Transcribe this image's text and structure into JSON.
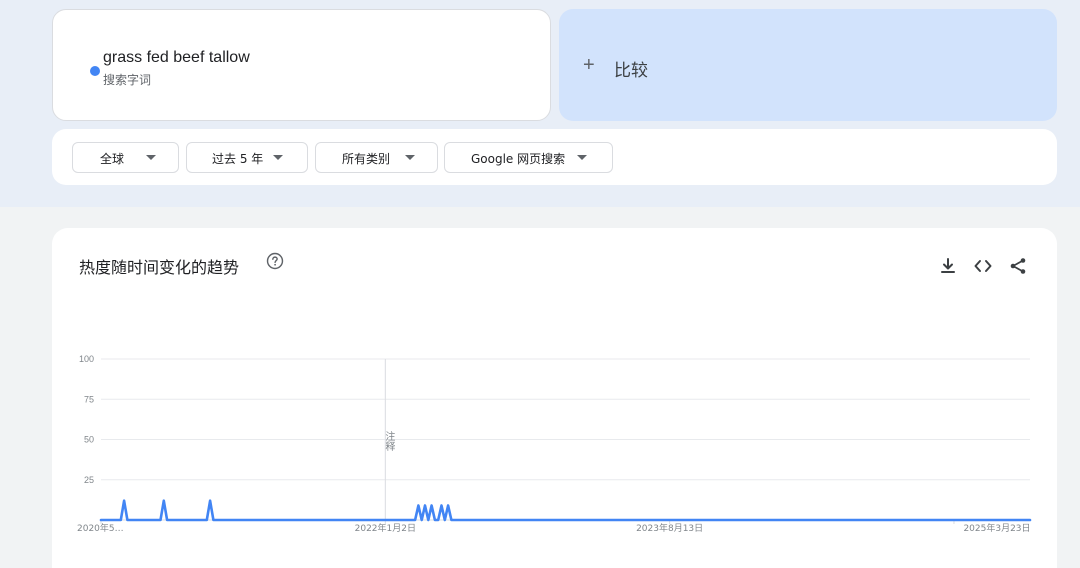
{
  "search_term": {
    "name": "grass fed beef tallow",
    "subtitle": "搜索字词",
    "color": "#4285f4"
  },
  "compare": {
    "plus": "+",
    "label": "比较"
  },
  "filters": [
    {
      "label": "全球"
    },
    {
      "label": "过去 5 年"
    },
    {
      "label": "所有类别"
    },
    {
      "label": "Google 网页搜索"
    }
  ],
  "chart_section": {
    "title": "热度随时间变化的趋势",
    "note_label": "注释"
  },
  "chart_data": {
    "type": "line",
    "xlabel": "",
    "ylabel": "",
    "ylim": [
      0,
      100
    ],
    "y_ticks": [
      25,
      50,
      75,
      100
    ],
    "x_tick_labels": [
      "2020年5…",
      "2022年1月2日",
      "2023年8月13日",
      "2025年3月23日"
    ],
    "x_tick_index": [
      0,
      86,
      172,
      258
    ],
    "note_index": 86,
    "grid": true,
    "series": [
      {
        "color": "#4285f4",
        "values": [
          0,
          0,
          0,
          0,
          0,
          0,
          0,
          12,
          0,
          0,
          0,
          0,
          0,
          0,
          0,
          0,
          0,
          0,
          0,
          12,
          0,
          0,
          0,
          0,
          0,
          0,
          0,
          0,
          0,
          0,
          0,
          0,
          0,
          12,
          0,
          0,
          0,
          0,
          0,
          0,
          0,
          0,
          0,
          0,
          0,
          0,
          0,
          0,
          0,
          0,
          0,
          0,
          0,
          0,
          0,
          0,
          0,
          0,
          0,
          0,
          0,
          0,
          0,
          0,
          0,
          0,
          0,
          0,
          0,
          0,
          0,
          0,
          0,
          0,
          0,
          0,
          0,
          0,
          0,
          0,
          0,
          0,
          0,
          0,
          0,
          0,
          0,
          0,
          0,
          0,
          0,
          0,
          0,
          0,
          0,
          0,
          9,
          0,
          9,
          0,
          9,
          0,
          0,
          9,
          0,
          9,
          0,
          0,
          0,
          0,
          0,
          0,
          0,
          0,
          0,
          0,
          0,
          0,
          0,
          0,
          0,
          0,
          0,
          0,
          0,
          0,
          0,
          0,
          0,
          0,
          0,
          0,
          0,
          0,
          0,
          0,
          0,
          0,
          0,
          0,
          0,
          0,
          0,
          0,
          0,
          0,
          0,
          0,
          0,
          0,
          0,
          0,
          0,
          0,
          0,
          0,
          0,
          0,
          0,
          0,
          0,
          0,
          0,
          0,
          0,
          0,
          0,
          0,
          0,
          0,
          0,
          0,
          0,
          0,
          0,
          0,
          0,
          0,
          0,
          0,
          0,
          0,
          0,
          0,
          0,
          0,
          0,
          0,
          0,
          0,
          0,
          0,
          0,
          0,
          0,
          0,
          0,
          0,
          0,
          0,
          0,
          0,
          0,
          0,
          0,
          0,
          0,
          0,
          0,
          0,
          0,
          0,
          0,
          0,
          0,
          0,
          0,
          0,
          0,
          0,
          0,
          0,
          0,
          0,
          0,
          0,
          0,
          0,
          0,
          0,
          0,
          0,
          0,
          0,
          0,
          0,
          0,
          0,
          0,
          0,
          0,
          0,
          0,
          0,
          0,
          0,
          0,
          0,
          0,
          0,
          0,
          0,
          0,
          0,
          0,
          0,
          0,
          0,
          0,
          0,
          0,
          0,
          0,
          0,
          0,
          0,
          0,
          0,
          0,
          0,
          0,
          0,
          0,
          0,
          0,
          0,
          0,
          0,
          0,
          0,
          0,
          0
        ]
      }
    ]
  }
}
